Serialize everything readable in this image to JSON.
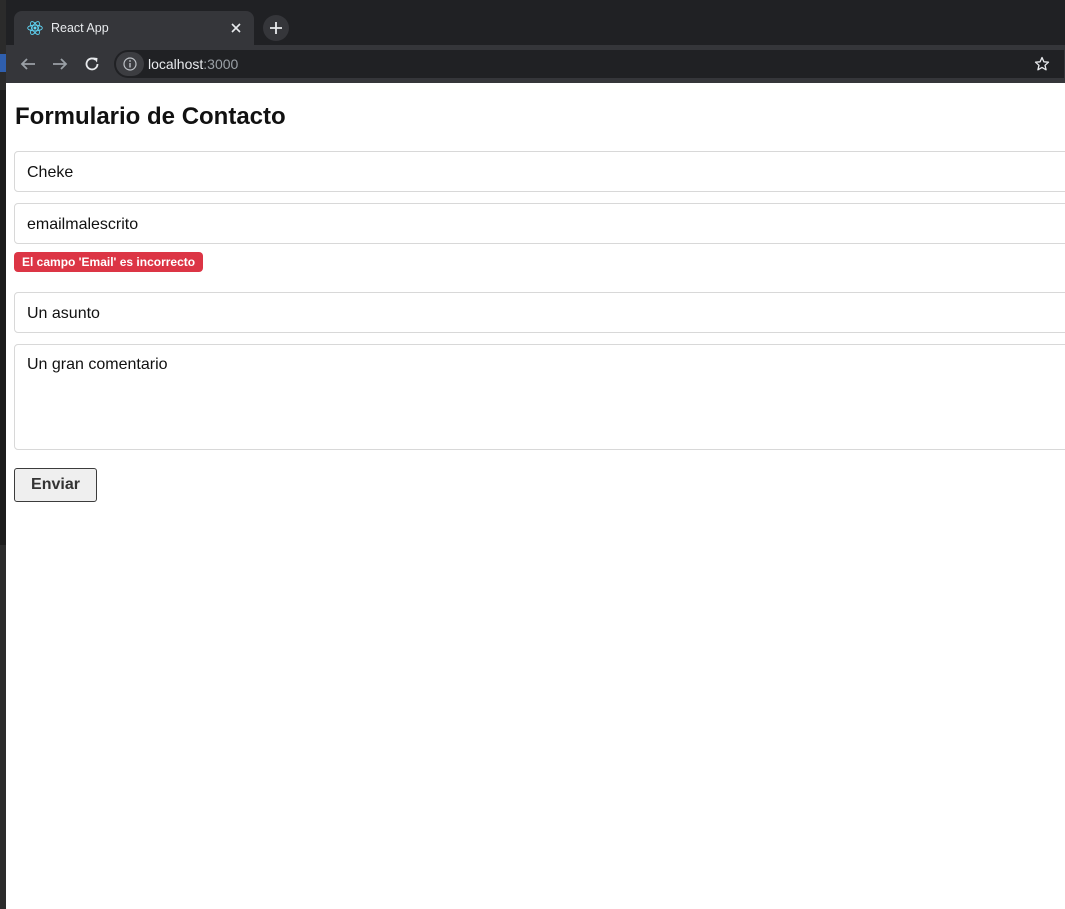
{
  "browser": {
    "tab_title": "React App",
    "url_host": "localhost",
    "url_port": ":3000",
    "new_tab_icon": "plus-icon",
    "close_icon": "close-icon",
    "colors": {
      "tabbar_bg": "#202124",
      "toolbar_bg": "#35363a",
      "react_logo": "#61dafb"
    }
  },
  "form": {
    "title": "Formulario de Contacto",
    "name_value": "Cheke",
    "email_value": "emailmalescrito",
    "email_error": "El campo 'Email' es incorrecto",
    "subject_value": "Un asunto",
    "comment_value": "Un gran comentario",
    "submit_label": "Enviar",
    "colors": {
      "error_badge": "#dc3545",
      "field_border": "#d8d8d8"
    }
  }
}
